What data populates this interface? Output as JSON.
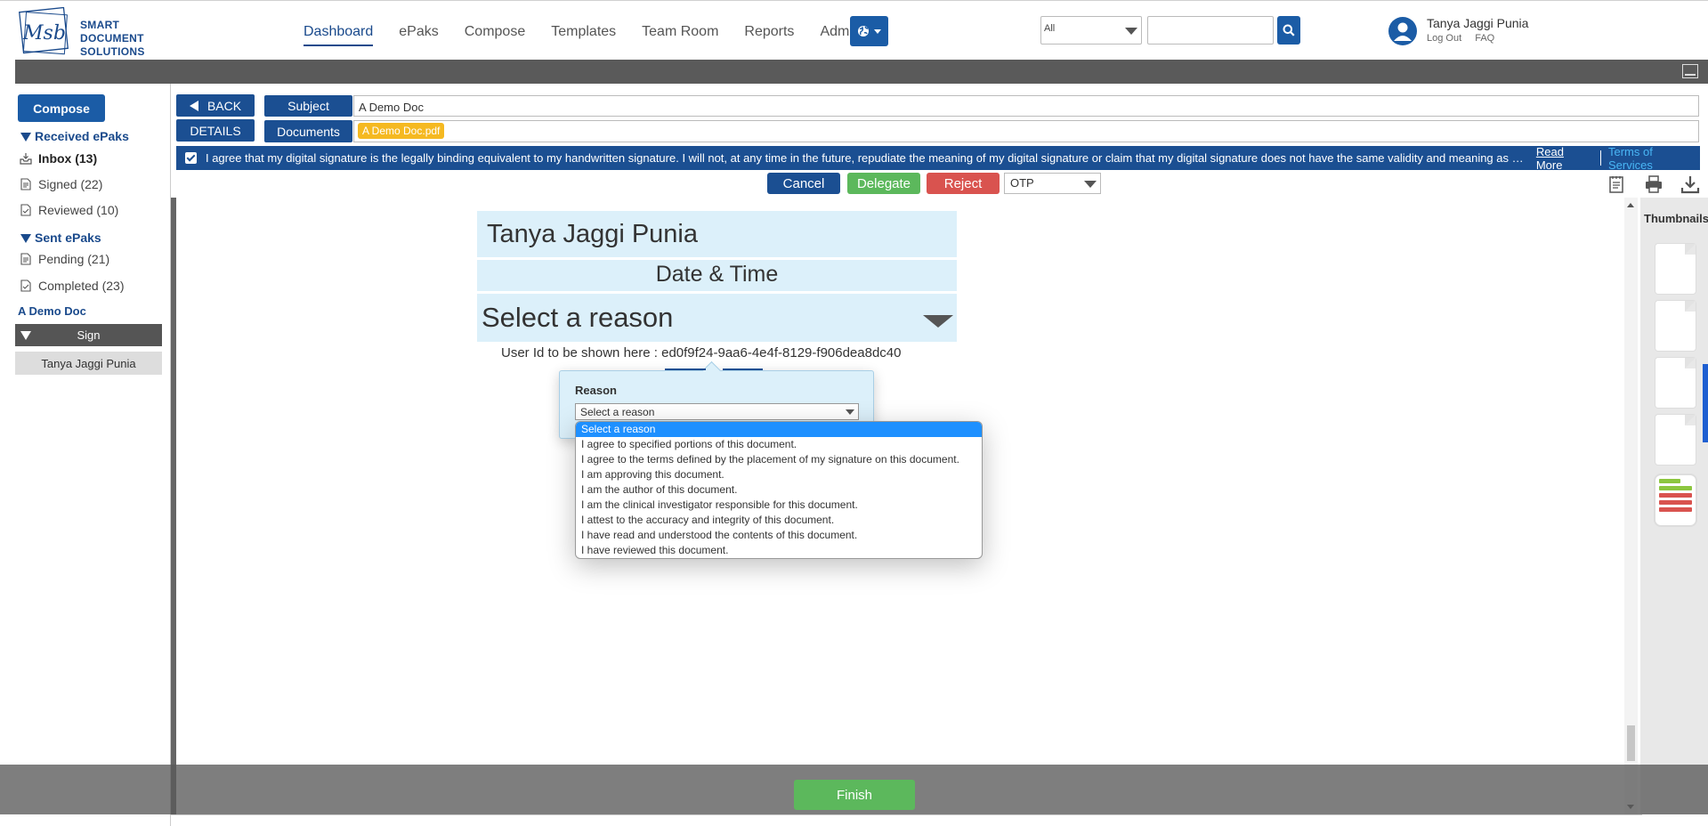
{
  "logo": {
    "line1": "SMART DOCUMENT",
    "line2": "SOLUTIONS"
  },
  "nav": {
    "items": [
      {
        "label": "Dashboard",
        "active": true
      },
      {
        "label": "ePaks"
      },
      {
        "label": "Compose"
      },
      {
        "label": "Templates"
      },
      {
        "label": "Team Room"
      },
      {
        "label": "Reports"
      },
      {
        "label": "Admin"
      }
    ],
    "globe_icon": "globe-icon"
  },
  "search": {
    "scope": "All",
    "placeholder": ""
  },
  "user": {
    "name": "Tanya Jaggi Punia",
    "logout": "Log Out",
    "faq": "FAQ"
  },
  "sidebar": {
    "compose": "Compose",
    "received_title": "Received ePaks",
    "received": [
      {
        "label": "Inbox (13)"
      },
      {
        "label": "Signed (22)"
      },
      {
        "label": "Reviewed (10)"
      }
    ],
    "sent_title": "Sent ePaks",
    "sent": [
      {
        "label": "Pending (21)"
      },
      {
        "label": "Completed (23)"
      }
    ],
    "doc_name": "A Demo Doc",
    "step": "Sign",
    "signer": "Tanya Jaggi Punia"
  },
  "header": {
    "back": "BACK",
    "subject_label": "Subject",
    "subject_value": "A Demo Doc",
    "details": "DETAILS",
    "documents_label": "Documents",
    "document_chip": "A Demo Doc.pdf",
    "agreement": "I agree that my digital signature is the legally binding equivalent to my handwritten signature. I will not, at any time in the future, repudiate the meaning of my digital signature or claim that my digital signature does not have the same validity and meaning as my handwritten signature.",
    "read_more": "Read More",
    "terms": "Terms of Services"
  },
  "actions": {
    "cancel": "Cancel",
    "delegate": "Delegate",
    "reject": "Reject",
    "auth": "OTP"
  },
  "signature": {
    "name": "Tanya Jaggi Punia",
    "date": "Date & Time",
    "reason_placeholder": "Select a reason",
    "user_id": "User Id to be shown here : ed0f9f24-9aa6-4e4f-8129-f906dea8dc40"
  },
  "reason_popover": {
    "label": "Reason",
    "selected": "Select a reason",
    "options": [
      "Select a reason",
      "I agree to specified portions of this document.",
      "I agree to the terms defined by the placement of my signature on this document.",
      "I am approving this document.",
      "I am the author of this document.",
      "I am the clinical investigator responsible for this document.",
      "I attest to the accuracy and integrity of this document.",
      "I have read and understood the contents of this document.",
      "I have reviewed this document."
    ]
  },
  "thumbnails": {
    "title": "Thumbnails"
  },
  "finish": "Finish",
  "colors": {
    "primary": "#1b4f92",
    "success": "#5cb85c",
    "danger": "#d9534f",
    "chip": "#f5b921",
    "field_bg": "#dcf0fa"
  }
}
